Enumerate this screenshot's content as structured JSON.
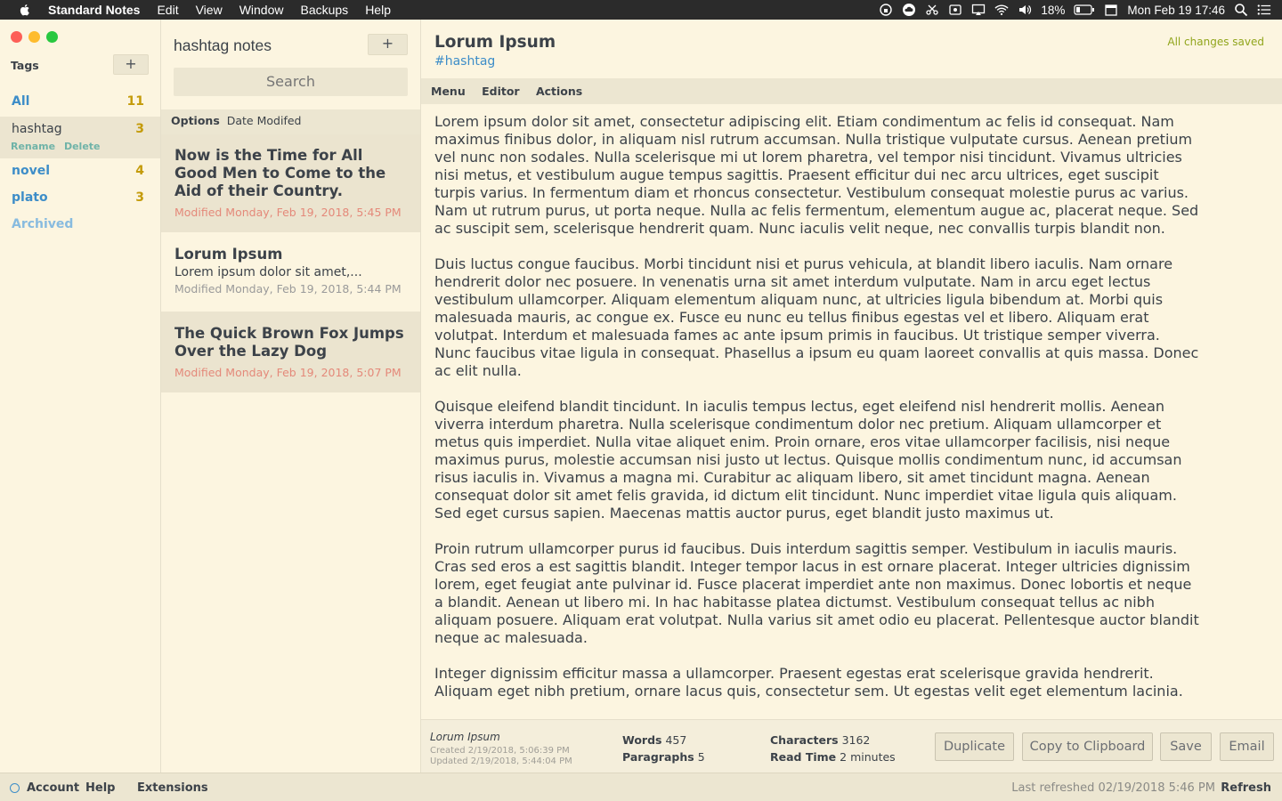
{
  "menubar": {
    "app": "Standard Notes",
    "items": [
      "Edit",
      "View",
      "Window",
      "Backups",
      "Help"
    ],
    "battery": "18%",
    "datetime": "Mon Feb 19  17:46"
  },
  "tags": {
    "title": "Tags",
    "add": "+",
    "items": [
      {
        "label": "All",
        "count": "11"
      },
      {
        "label": "hashtag",
        "count": "3",
        "rename": "Rename",
        "delete": "Delete"
      },
      {
        "label": "novel",
        "count": "4"
      },
      {
        "label": "plato",
        "count": "3"
      },
      {
        "label": "Archived"
      }
    ]
  },
  "notes": {
    "title": "hashtag notes",
    "add": "+",
    "search_placeholder": "Search",
    "options_label": "Options",
    "sort_label": "Date Modifed",
    "items": [
      {
        "title": "Now is the Time for All Good Men to Come to the Aid of their Country.",
        "date": "Modified Monday, Feb 19, 2018, 5:45 PM"
      },
      {
        "title": "Lorum Ipsum",
        "preview": "Lorem ipsum dolor sit amet,...",
        "date": "Modified Monday, Feb 19, 2018, 5:44 PM"
      },
      {
        "title": "The Quick Brown Fox Jumps Over the Lazy Dog",
        "date": "Modified Monday, Feb 19, 2018, 5:07 PM"
      }
    ]
  },
  "editor": {
    "title": "Lorum Ipsum",
    "tag": "#hashtag",
    "saved": "All changes saved",
    "menu": [
      "Menu",
      "Editor",
      "Actions"
    ],
    "paragraphs": [
      "Lorem ipsum dolor sit amet, consectetur adipiscing elit. Etiam condimentum ac felis id consequat. Nam maximus finibus dolor, in aliquam nisl rutrum accumsan. Nulla tristique vulputate cursus. Aenean pretium vel nunc non sodales. Nulla scelerisque mi ut lorem pharetra, vel tempor nisi tincidunt. Vivamus ultricies nisi metus, et vestibulum augue tempus sagittis. Praesent efficitur dui nec arcu ultrices, eget suscipit turpis varius. In fermentum diam et rhoncus consectetur. Vestibulum consequat molestie purus ac varius. Nam ut rutrum purus, ut porta neque. Nulla ac felis fermentum, elementum augue ac, placerat neque. Sed ac suscipit sem, scelerisque hendrerit quam. Nunc iaculis velit neque, nec convallis turpis blandit non.",
      "Duis luctus congue faucibus. Morbi tincidunt nisi et purus vehicula, at blandit libero iaculis. Nam ornare hendrerit dolor nec posuere. In venenatis urna sit amet interdum vulputate. Nam in arcu eget lectus vestibulum ullamcorper. Aliquam elementum aliquam nunc, at ultricies ligula bibendum at. Morbi quis malesuada mauris, ac congue ex. Fusce eu nunc eu tellus finibus egestas vel et libero. Aliquam erat volutpat. Interdum et malesuada fames ac ante ipsum primis in faucibus. Ut tristique semper viverra. Nunc faucibus vitae ligula in consequat. Phasellus a ipsum eu quam laoreet convallis at quis massa. Donec ac elit nulla.",
      "Quisque eleifend blandit tincidunt. In iaculis tempus lectus, eget eleifend nisl hendrerit mollis. Aenean viverra interdum pharetra. Nulla scelerisque condimentum dolor nec pretium. Aliquam ullamcorper et metus quis imperdiet. Nulla vitae aliquet enim. Proin ornare, eros vitae ullamcorper facilisis, nisi neque maximus purus, molestie accumsan nisi justo ut lectus. Quisque mollis condimentum nunc, id accumsan risus iaculis in. Vivamus a magna mi. Curabitur ac aliquam libero, sit amet tincidunt magna. Aenean consequat dolor sit amet felis gravida, id dictum elit tincidunt. Nunc imperdiet vitae ligula quis aliquam. Sed eget cursus sapien. Maecenas mattis auctor purus, eget blandit justo maximus ut.",
      "Proin rutrum ullamcorper purus id faucibus. Duis interdum sagittis semper. Vestibulum in iaculis mauris. Cras sed eros a est sagittis blandit. Integer tempor lacus in est ornare placerat. Integer ultricies dignissim lorem, eget feugiat ante pulvinar id. Fusce placerat imperdiet ante non maximus. Donec lobortis et neque a blandit. Aenean ut libero mi. In hac habitasse platea dictumst. Vestibulum consequat tellus ac nibh aliquam posuere. Aliquam erat volutpat. Nulla varius sit amet odio eu placerat. Pellentesque auctor blandit neque ac malesuada.",
      "Integer dignissim efficitur massa a ullamcorper. Praesent egestas erat scelerisque gravida hendrerit. Aliquam eget nibh pretium, ornare lacus quis, consectetur sem. Ut egestas velit eget elementum lacinia."
    ]
  },
  "footer": {
    "note_name": "Lorum Ipsum",
    "created": "Created 2/19/2018, 5:06:39 PM",
    "updated": "Updated 2/19/2018, 5:44:04 PM",
    "words_label": "Words",
    "words": "457",
    "paragraphs_label": "Paragraphs",
    "paragraphs": "5",
    "characters_label": "Characters",
    "characters": "3162",
    "readtime_label": "Read Time",
    "readtime": "2 minutes",
    "buttons": [
      "Duplicate",
      "Copy to Clipboard",
      "Save",
      "Email"
    ]
  },
  "status": {
    "account": "Account",
    "help": "Help",
    "extensions": "Extensions",
    "last_refreshed": "Last refreshed 02/19/2018 5:46 PM",
    "refresh": "Refresh"
  },
  "colors": {
    "background": "#fcf5e0",
    "accent_blue": "#3d8dc8",
    "count_yellow": "#c49b0a",
    "saved_green": "#91a51c",
    "date_red": "#e4897a"
  }
}
